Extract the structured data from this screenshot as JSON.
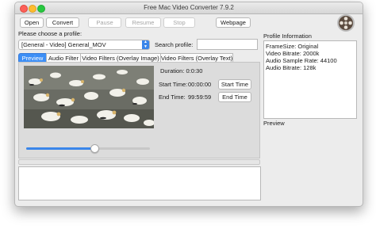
{
  "window": {
    "title": "Free Mac Video Converter 7.9.2"
  },
  "toolbar": {
    "open": "Open",
    "convert": "Convert",
    "pause": "Pause",
    "resume": "Resume",
    "stop": "Stop",
    "webpage": "Webpage"
  },
  "profile": {
    "label": "Please choose a profile:",
    "selected": "[General - Video] General_MOV",
    "search_label": "Search profile:",
    "search_value": ""
  },
  "tabs": [
    {
      "label": "Preview",
      "active": true
    },
    {
      "label": "Audio Filter",
      "active": false
    },
    {
      "label": "Video Filters (Overlay Image)",
      "active": false
    },
    {
      "label": "Video Filters (Overlay Text)",
      "active": false
    }
  ],
  "preview": {
    "duration": "Duration: 0:0:30",
    "start_label": "Start Time:",
    "start_value": "00:00:00",
    "start_button": "Start Time",
    "end_label": "End Time:",
    "end_value": "99:59:59",
    "end_button": "End Time",
    "slider_position": 0.55
  },
  "info": {
    "header": "Profile Information",
    "lines": [
      "FrameSize: Original",
      "Video Bitrate: 2000k",
      "Audio Sample Rate: 44100",
      "Audio Bitrate: 128k"
    ],
    "preview_label": "Preview"
  },
  "colors": {
    "accent": "#3d8ff6",
    "window_bg": "#ececec",
    "close": "#fd5f57",
    "minimize": "#febc2e",
    "maximize": "#28c840"
  },
  "icons": {
    "app_logo": "film-reel-icon",
    "dropdown": "chevron-updown-icon"
  }
}
